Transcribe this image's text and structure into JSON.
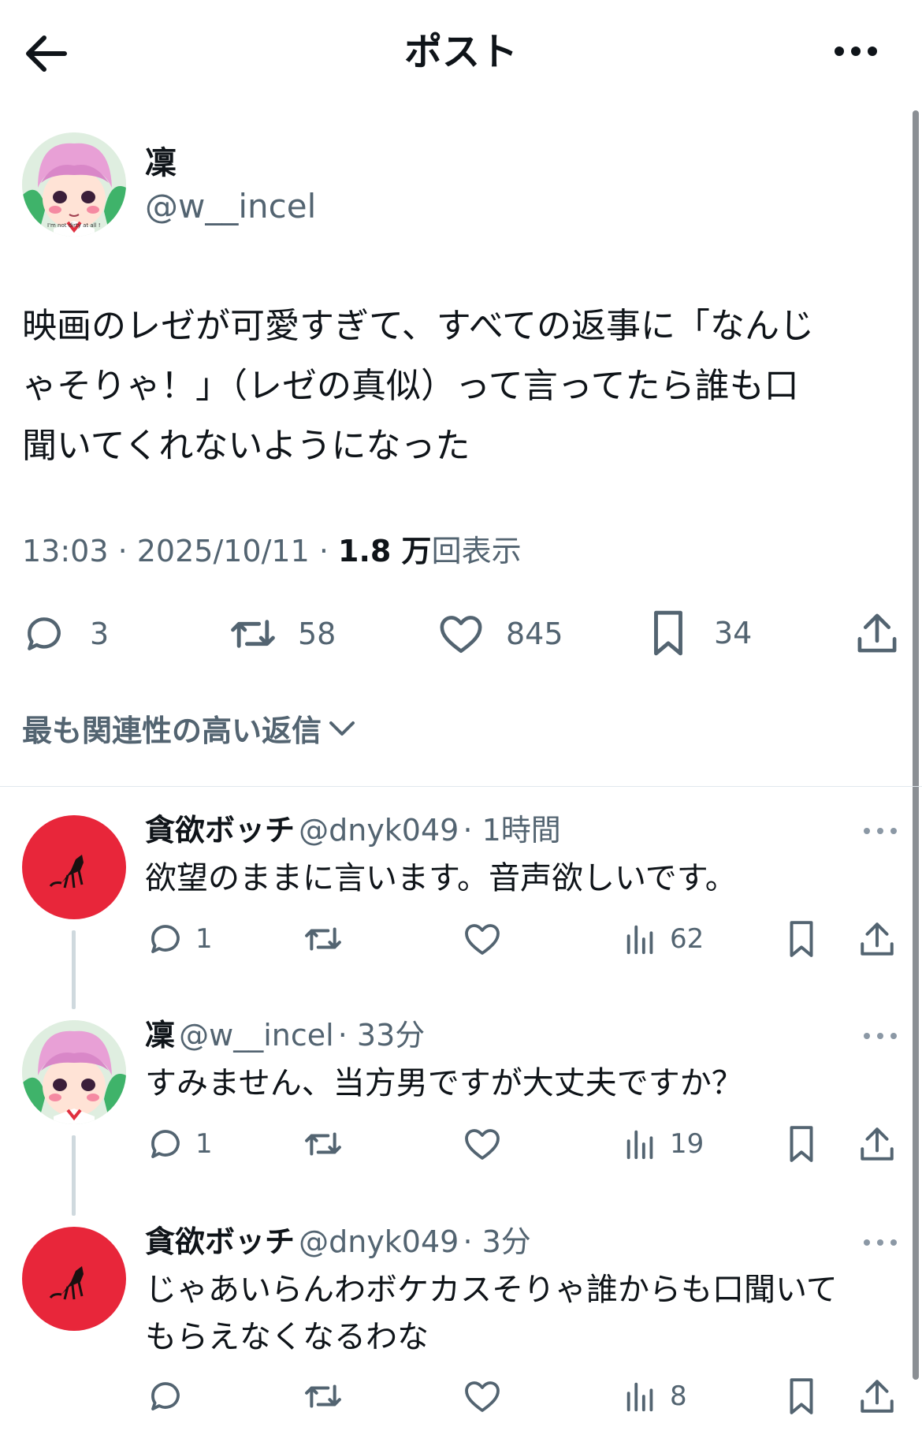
{
  "header": {
    "title": "ポスト"
  },
  "post": {
    "author": {
      "name": "凜",
      "handle": "@w__incel"
    },
    "avatar_caption": "I'm not dirty at all !",
    "text_lines": [
      "映画のレゼが可愛すぎて、すべての返事に「なんじ",
      "ゃそりゃ！」（レゼの真似）って言ってたら誰も口",
      "聞いてくれないようになった"
    ],
    "time": "13:03 · 2025/10/11 · ",
    "views_count": "1.8 万",
    "views_label": "回表示",
    "stats": {
      "replies": "3",
      "reposts": "58",
      "likes": "845",
      "bookmarks": "34"
    }
  },
  "sort": {
    "label": "最も関連性の高い返信"
  },
  "replies": [
    {
      "name": "貪欲ボッチ",
      "handle": "@dnyk049",
      "time": "· 1時間",
      "text": [
        "欲望のままに言います。音声欲しいです。"
      ],
      "replies": "1",
      "views": "62"
    },
    {
      "name": "凜",
      "handle": "@w__incel",
      "time": "· 33分",
      "text": [
        "すみません、当方男ですが大丈夫ですか？"
      ],
      "replies": "1",
      "views": "19"
    },
    {
      "name": "貪欲ボッチ",
      "handle": "@dnyk049",
      "time": "· 3分",
      "text": [
        "じゃあいらんわボケカスそりゃ誰からも口聞いて",
        "もらえなくなるわな"
      ],
      "replies": "",
      "views": "8"
    }
  ],
  "colors": {
    "accent_red": "#e8263a",
    "text": "#0f1419",
    "muted": "#536471"
  }
}
